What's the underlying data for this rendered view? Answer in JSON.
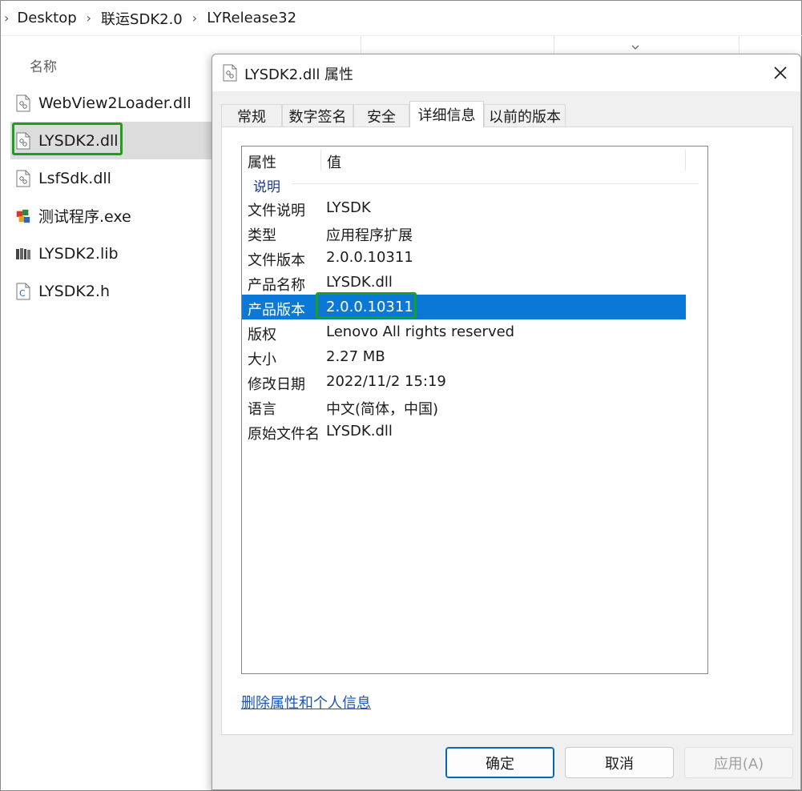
{
  "breadcrumb": {
    "items": [
      "Desktop",
      "联运SDK2.0",
      "LYRelease32"
    ]
  },
  "explorer": {
    "column_header": "名称",
    "files": [
      {
        "name": "WebView2Loader.dll",
        "icon": "dll-file-icon"
      },
      {
        "name": "LYSDK2.dll",
        "icon": "dll-file-icon"
      },
      {
        "name": "LsfSdk.dll",
        "icon": "dll-file-icon"
      },
      {
        "name": "测试程序.exe",
        "icon": "exe-app-icon"
      },
      {
        "name": "LYSDK2.lib",
        "icon": "lib-file-icon"
      },
      {
        "name": "LYSDK2.h",
        "icon": "c-header-file-icon"
      }
    ],
    "selected_file": "LYSDK2.dll"
  },
  "dialog": {
    "title": "LYSDK2.dll 属性",
    "tabs": [
      "常规",
      "数字签名",
      "安全",
      "详细信息",
      "以前的版本"
    ],
    "active_tab": "详细信息",
    "list_headers": {
      "property": "属性",
      "value": "值"
    },
    "group_label": "说明",
    "rows": [
      {
        "key": "文件说明",
        "value": "LYSDK"
      },
      {
        "key": "类型",
        "value": "应用程序扩展"
      },
      {
        "key": "文件版本",
        "value": "2.0.0.10311"
      },
      {
        "key": "产品名称",
        "value": "LYSDK.dll"
      },
      {
        "key": "产品版本",
        "value": "2.0.0.10311"
      },
      {
        "key": "版权",
        "value": "Lenovo All rights reserved"
      },
      {
        "key": "大小",
        "value": "2.27 MB"
      },
      {
        "key": "修改日期",
        "value": "2022/11/2 15:19"
      },
      {
        "key": "语言",
        "value": "中文(简体，中国)"
      },
      {
        "key": "原始文件名",
        "value": "LYSDK.dll"
      }
    ],
    "selected_row": "产品版本",
    "remove_link": "删除属性和个人信息",
    "buttons": {
      "ok": "确定",
      "cancel": "取消",
      "apply": "应用(A)"
    }
  },
  "colors": {
    "selection_blue": "#0a78d7",
    "highlight_green": "#1aa01a",
    "link_blue": "#1a56b8",
    "group_text": "#1e3a8a"
  }
}
